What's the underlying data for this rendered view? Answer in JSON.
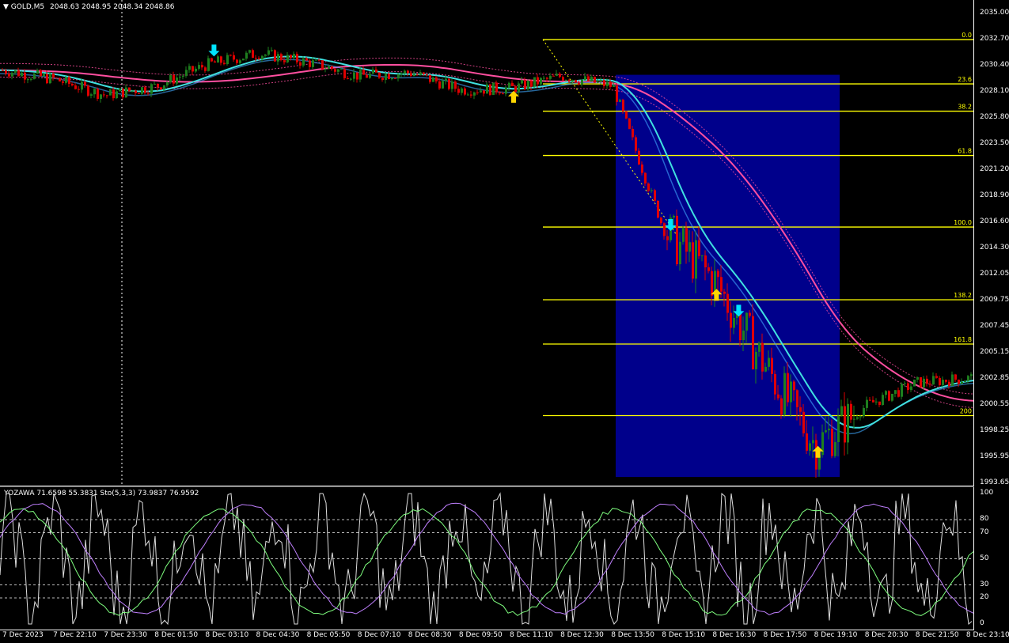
{
  "symbol_header": {
    "arrow": "▼",
    "symbol": "GOLD,M5",
    "ohlc": "2048.63 2048.95 2048.34 2048.86"
  },
  "oscillator_header": {
    "text": "YOZAWA 71.6598 55.3831 Sto(5,3,3) 73.9837 76.9592"
  },
  "price_scale": {
    "min": 1993.65,
    "max": 2035.0,
    "labels": [
      "2035.00",
      "2032.70",
      "2030.40",
      "2028.10",
      "2025.80",
      "2023.50",
      "2021.20",
      "2018.90",
      "2016.60",
      "2014.30",
      "2012.05",
      "2009.75",
      "2007.45",
      "2005.15",
      "2002.85",
      "2000.55",
      "1998.25",
      "1995.95",
      "1993.65"
    ]
  },
  "osc_scale": {
    "labels": [
      "100",
      "80",
      "70",
      "50",
      "30",
      "20",
      "0"
    ]
  },
  "fibonacci": {
    "levels": [
      {
        "label": "0.0",
        "price": 2032.7
      },
      {
        "label": "23.6",
        "price": 2028.8
      },
      {
        "label": "38.2",
        "price": 2026.4
      },
      {
        "label": "61.8",
        "price": 2022.5
      },
      {
        "label": "100.0",
        "price": 2016.2
      },
      {
        "label": "138.2",
        "price": 2009.8
      },
      {
        "label": "161.8",
        "price": 2005.9
      },
      {
        "label": "200",
        "price": 1999.6
      }
    ]
  },
  "time_axis": {
    "labels": [
      "7 Dec 2023",
      "7 Dec 22:10",
      "7 Dec 23:30",
      "8 Dec 01:50",
      "8 Dec 03:10",
      "8 Dec 04:30",
      "8 Dec 05:50",
      "8 Dec 07:10",
      "8 Dec 08:30",
      "8 Dec 09:50",
      "8 Dec 11:10",
      "8 Dec 12:30",
      "8 Dec 13:50",
      "8 Dec 15:10",
      "8 Dec 16:30",
      "8 Dec 17:50",
      "8 Dec 19:10",
      "8 Dec 20:30",
      "8 Dec 21:50",
      "8 Dec 23:10"
    ]
  },
  "chart_data": {
    "type": "candlestick",
    "symbol": "GOLD",
    "timeframe": "M5",
    "close_path": [
      {
        "t": "7 Dec 2023",
        "price": 2030.0
      },
      {
        "t": "7 Dec 22:10",
        "price": 2029.2
      },
      {
        "t": "7 Dec 23:30",
        "price": 2027.8
      },
      {
        "t": "8 Dec 01:50",
        "price": 2028.6
      },
      {
        "t": "8 Dec 03:10",
        "price": 2030.5
      },
      {
        "t": "8 Dec 04:30",
        "price": 2031.5
      },
      {
        "t": "8 Dec 05:50",
        "price": 2030.7
      },
      {
        "t": "8 Dec 07:10",
        "price": 2029.5
      },
      {
        "t": "8 Dec 08:30",
        "price": 2029.8
      },
      {
        "t": "8 Dec 09:50",
        "price": 2028.3
      },
      {
        "t": "8 Dec 11:10",
        "price": 2028.4
      },
      {
        "t": "8 Dec 12:30",
        "price": 2029.5
      },
      {
        "t": "8 Dec 13:50",
        "price": 2028.6
      },
      {
        "t": "8 Dec 15:10",
        "price": 2016.0
      },
      {
        "t": "8 Dec 16:30",
        "price": 2011.5
      },
      {
        "t": "8 Dec 17:50",
        "price": 2004.0
      },
      {
        "t": "8 Dec 19:10",
        "price": 1997.0
      },
      {
        "t": "8 Dec 20:30",
        "price": 2000.5
      },
      {
        "t": "8 Dec 21:50",
        "price": 2002.5
      },
      {
        "t": "8 Dec 23:10",
        "price": 2002.9
      }
    ],
    "signals": [
      {
        "t": "8 Dec 03:10",
        "direction": "down",
        "color": "#00e5ff"
      },
      {
        "t": "8 Dec 11:10",
        "direction": "up",
        "color": "#ffd700"
      },
      {
        "t": "8 Dec 15:10",
        "direction": "down",
        "color": "#00e5ff"
      },
      {
        "t": "8 Dec 16:30",
        "direction": "up",
        "color": "#ffd700"
      },
      {
        "t": "8 Dec 16:30",
        "direction": "down",
        "color": "#00e5ff"
      },
      {
        "t": "8 Dec 19:10",
        "direction": "up",
        "color": "#ffd700"
      }
    ],
    "colors": {
      "bull": "#1e7f1e",
      "bear": "#e00000",
      "fib": "#ffff00",
      "fast_ma": "#40e0e0",
      "slow_ma": "#ff4fa0",
      "box": "#00008b",
      "stoch_main": "#c080ff",
      "stoch_signal": "#7fff7f"
    }
  }
}
